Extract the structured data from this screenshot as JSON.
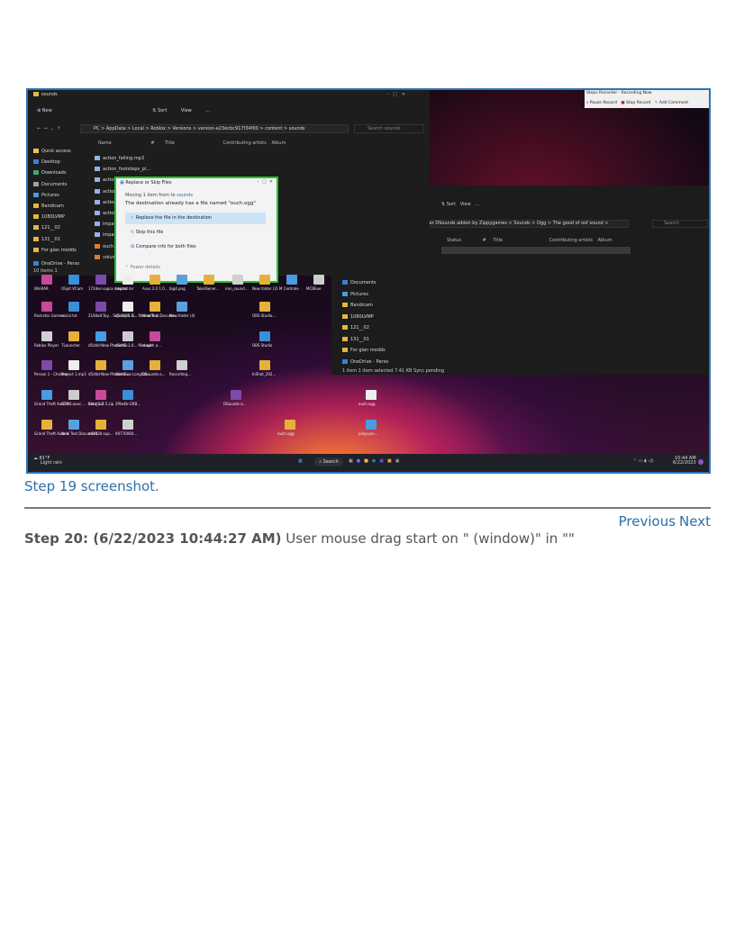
{
  "screenshot": {
    "explorer_front": {
      "title": "sounds",
      "toolbar": [
        "New",
        "Sort",
        "View",
        "..."
      ],
      "address": "PC > AppData > Local > Roblox > Versions > version-e23ecbc917f34f00 > content > sounds",
      "search_placeholder": "Search sounds",
      "columns": [
        "Name",
        "#",
        "Title",
        "Contributing artists",
        "Album"
      ],
      "files": [
        "action_falling.mp3",
        "action_footsteps_pl...",
        "action_",
        "action_",
        "action_",
        "action_",
        "impact",
        "impact",
        "ouch.o",
        "volume"
      ],
      "nav": [
        "Quick access",
        "Desktop",
        "Downloads",
        "Documents",
        "Pictures",
        "Bandicam",
        "1080LVMP",
        "121__02",
        "131__01",
        "For glan modds",
        "OneDrive - Perso"
      ],
      "status": "10 items  1"
    },
    "dialog": {
      "title": "Replace or Skip Files",
      "moving": "Moving 1 item from",
      "to_label": "to",
      "to_folder": "sounds",
      "message": "The destination already has a file named \"ouch.ogg\"",
      "options": [
        "Replace the file in the destination",
        "Skip this file",
        "Compare info for both files"
      ],
      "fewer_details": "Fewer details"
    },
    "explorer_back": {
      "address": "ster DSounds addon by Zippygames > Sounds > Ogg > The good of oof sound >",
      "search_placeholder": "Search",
      "toolbar": [
        "Sort",
        "View",
        "..."
      ],
      "columns": [
        "Status",
        "#",
        "Title",
        "Contributing artists",
        "Album"
      ],
      "nav": [
        "Documents",
        "Pictures",
        "Bandicam",
        "1080LVMP",
        "121__02",
        "131__01",
        "For glan modds",
        "OneDrive - Perso"
      ],
      "status": "1 item   1 item selected  7.41 KB   Sync pending"
    },
    "recorder": {
      "title": "Steps Recorder - Recording Now",
      "pause": "Pause Record",
      "stop": "Stop Record",
      "comment": "Add Comment"
    },
    "desktop_icons": [
      "WinRAR",
      "OSpit VCam",
      "172dec-supra release.rar",
      "Log.txt",
      "Asus 2.0 1.0...",
      "big4.png",
      "TakeOwner...",
      "iron_sound...",
      "New folder (2)",
      "M Centrale",
      "MCBEue",
      "Rockstar Games...",
      "serial.txt",
      "218da0-Toy... Supra J2E G...",
      "d5d4e-1.0... files with a...",
      "New Text Docume...",
      "New folder (4)",
      "OBS Studio...",
      "Roblox Player",
      "TLauncher",
      "d5d4d-New Phonet G...",
      "d5d4e-1.0... files with a...",
      "steps",
      "OBS Studio",
      "Person 1 - Chrome",
      "Project 1.mp3",
      "d5d4d-New Phonet G...",
      "Windows Longhor...",
      "DSounds-a...",
      "Recording...",
      "InShot_202...",
      "Grand Theft Auto V",
      "GTAVLaunc... - Shortcut",
      "beta_1.2.5.zip",
      "2f9e4b-GRB...",
      "DSounds-a...",
      "ouch.ogg",
      "Grand Theft Auto V",
      "New Text Document...",
      "a41020-sup...",
      "94770084...",
      "ouch.ogg",
      "ping-pon..."
    ],
    "taskbar": {
      "weather_temp": "81°F",
      "weather_text": "Light rain",
      "search": "Search",
      "time": "10:44 AM",
      "date": "6/22/2023"
    }
  },
  "caption": "Step 19 screenshot.",
  "nav": {
    "previous": "Previous",
    "next": "Next"
  },
  "step": {
    "label": "Step 20: (6/22/2023 10:44:27 AM)",
    "text": " User mouse drag start on \" (window)\" in \"\""
  }
}
